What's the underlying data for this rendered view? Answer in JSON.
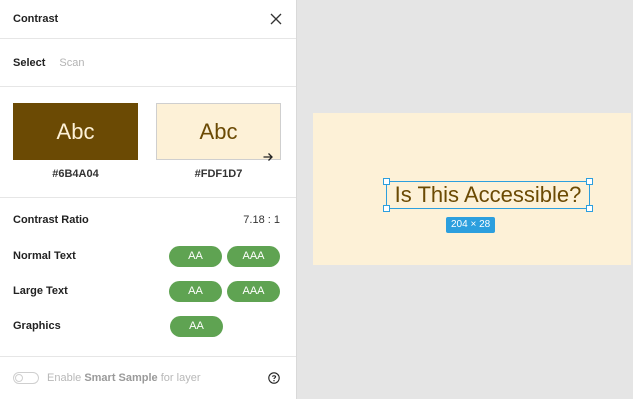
{
  "panel": {
    "title": "Contrast",
    "modes": [
      "Select",
      "Scan"
    ]
  },
  "colors": {
    "foreground": "#6B4A04",
    "background": "#FDF1D7",
    "foreground_label": "#6B4A04",
    "background_label": "#FDF1D7",
    "sample_text": "Abc",
    "badge_pass": "#5fa352",
    "selection_accent": "#2c9fde"
  },
  "results": {
    "ratio_label": "Contrast Ratio",
    "ratio_value": "7.18 : 1",
    "rows": [
      {
        "label": "Normal Text",
        "badges": [
          "AA",
          "AAA"
        ]
      },
      {
        "label": "Large Text",
        "badges": [
          "AA",
          "AAA"
        ]
      },
      {
        "label": "Graphics",
        "badges": [
          "AA"
        ]
      }
    ]
  },
  "footer": {
    "text_pre": "Enable ",
    "text_bold": "Smart Sample",
    "text_post": " for layer"
  },
  "canvas": {
    "sample_text": "Is This Accessible?",
    "dimensions": "204 × 28"
  },
  "icons": [
    "close-icon",
    "arrow-right-icon",
    "help-icon"
  ]
}
